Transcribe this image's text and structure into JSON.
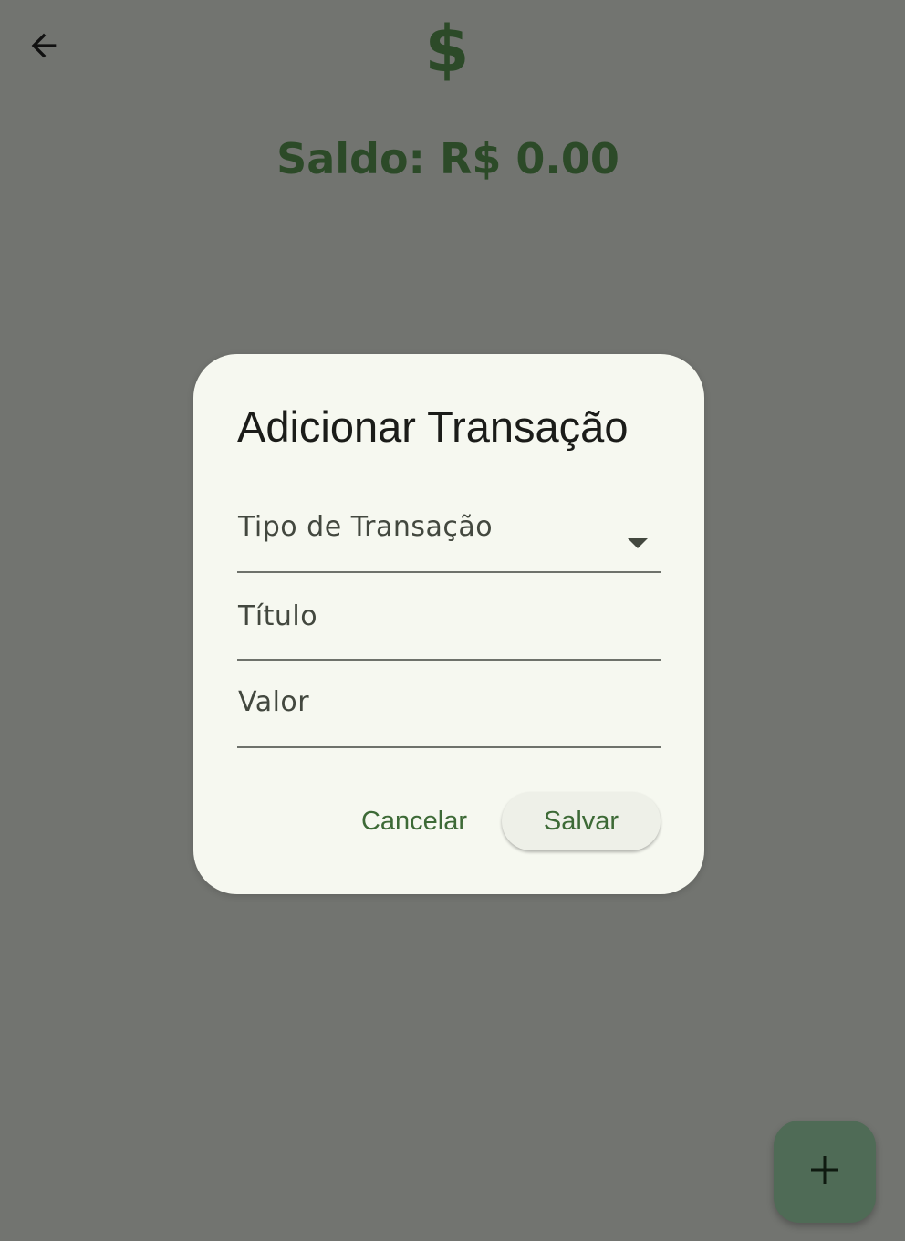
{
  "app_bar": {
    "back_icon": "arrow-left-icon",
    "logo_symbol": "$",
    "logo_color": "#2c4a28"
  },
  "balance": {
    "text": "Saldo: R$ 0.00"
  },
  "dialog": {
    "title": "Adicionar Transação",
    "fields": {
      "type": {
        "label": "Tipo de Transação",
        "icon": "dropdown-arrow-icon"
      },
      "title": {
        "label": "Título"
      },
      "value": {
        "label": "Valor"
      }
    },
    "actions": {
      "cancel_label": "Cancelar",
      "save_label": "Salvar"
    }
  },
  "fab": {
    "icon": "plus-icon"
  },
  "colors": {
    "scrim_background": "#727470",
    "dialog_surface": "#f6f8f0",
    "accent_green": "#3d6a36",
    "fab_background": "#4f6b56"
  }
}
